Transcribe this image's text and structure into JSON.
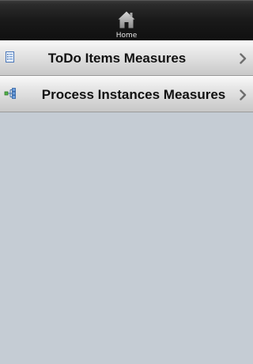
{
  "header": {
    "home_label": "Home",
    "home_icon": "home-icon"
  },
  "list": {
    "items": [
      {
        "label": "ToDo Items Measures",
        "icon": "document-list-icon"
      },
      {
        "label": "Process Instances Measures",
        "icon": "process-flow-icon"
      }
    ],
    "chevron_icon": "chevron-right-icon"
  },
  "colors": {
    "header_bg": "#1a1a1a",
    "page_bg": "#c5ccd4",
    "item_bg": "#e2e2e2",
    "chevron": "#7a7a7a"
  }
}
